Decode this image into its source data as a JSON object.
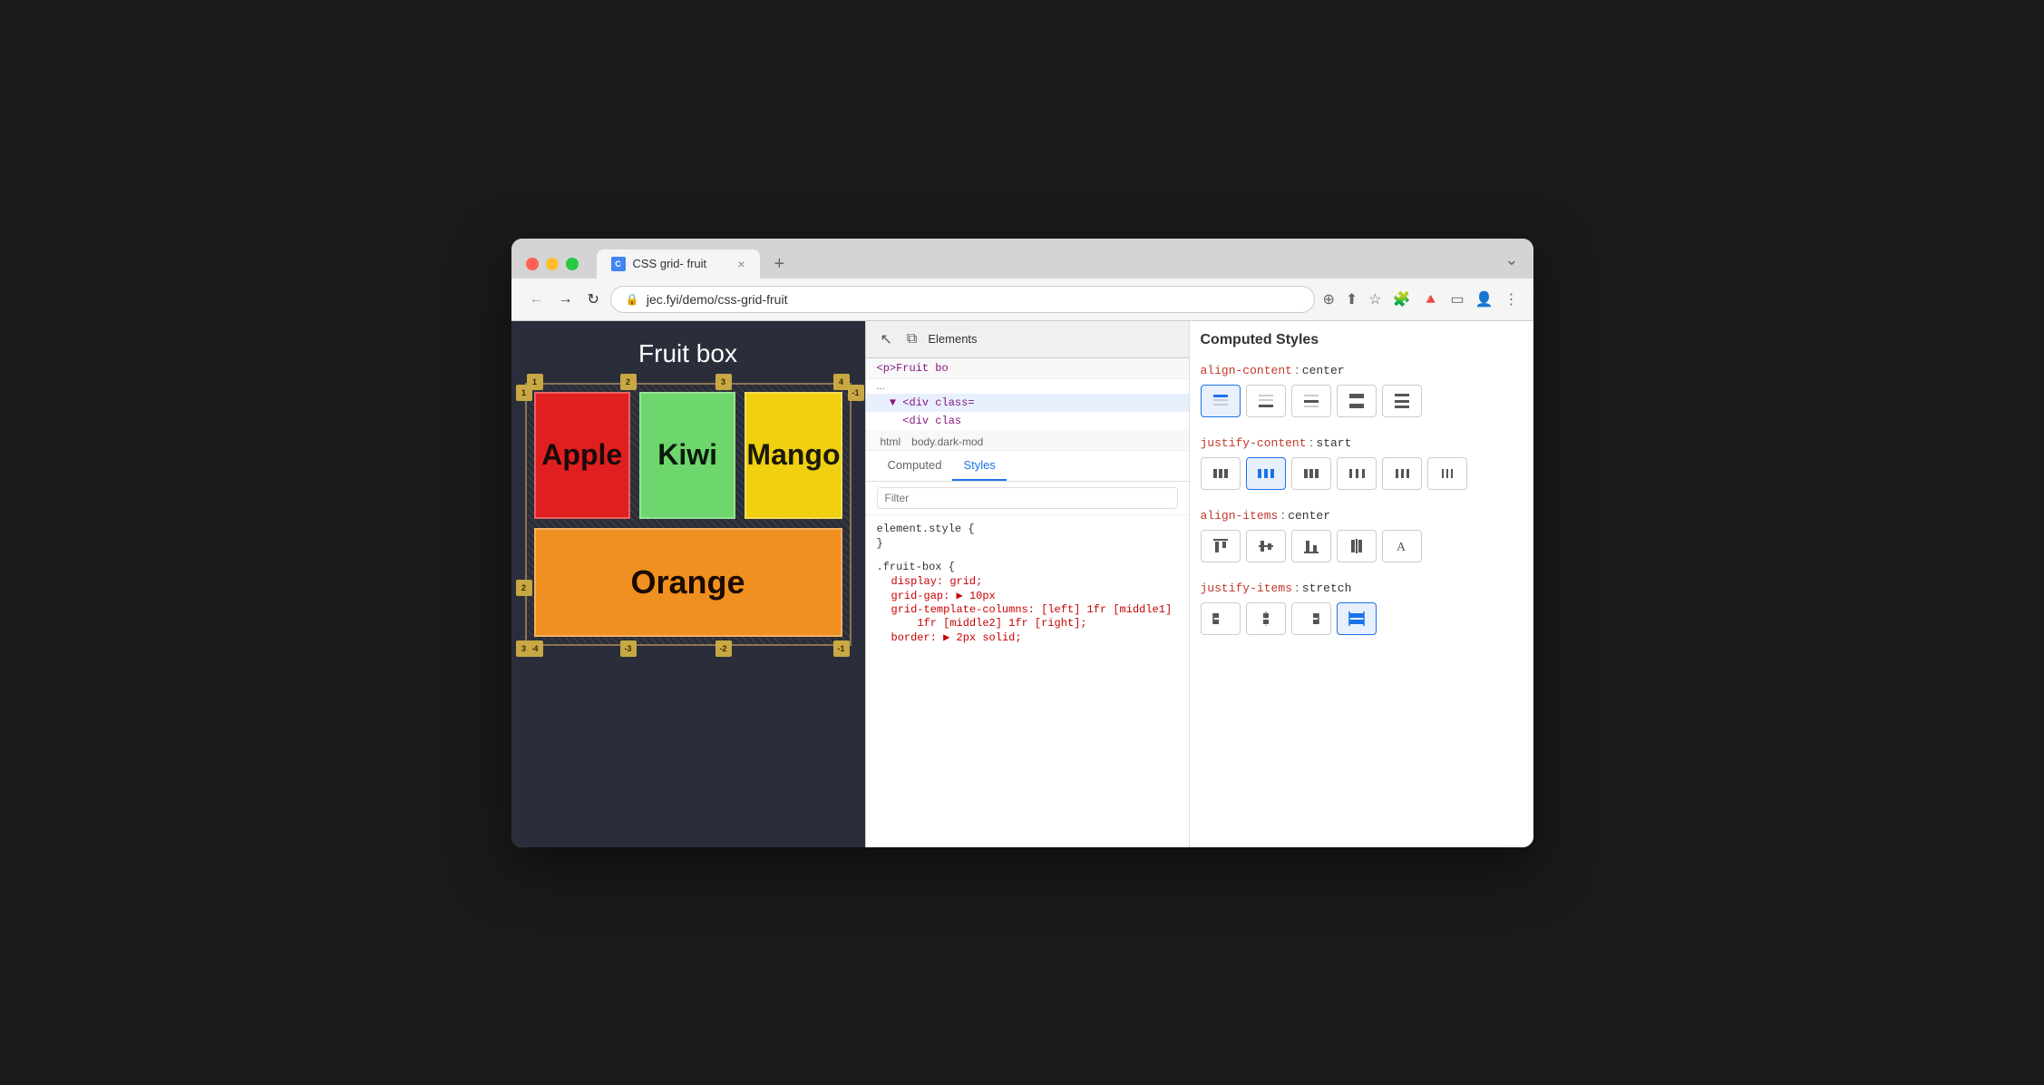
{
  "window": {
    "title": "CSS grid- fruit",
    "tab_favicon": "C",
    "url": "jec.fyi/demo/css-grid-fruit",
    "new_tab_label": "+"
  },
  "traffic_lights": {
    "red_label": "close",
    "yellow_label": "minimize",
    "green_label": "maximize"
  },
  "nav": {
    "back_icon": "←",
    "forward_icon": "→",
    "refresh_icon": "↻",
    "lock_icon": "🔒"
  },
  "webpage": {
    "title": "Fruit box",
    "fruits": [
      {
        "name": "Apple",
        "color": "#e02020",
        "text_color": "#1a0a0a"
      },
      {
        "name": "Kiwi",
        "color": "#6dd66d",
        "text_color": "#0a1a0a"
      },
      {
        "name": "Mango",
        "color": "#f0d010",
        "text_color": "#1a1a0a"
      },
      {
        "name": "Orange",
        "color": "#f09020",
        "text_color": "#1a0a00"
      }
    ]
  },
  "devtools": {
    "panel_title": "Elements",
    "dom_lines": [
      "<p>Fruit bo",
      "<div class=",
      "<div clas"
    ],
    "selectors": [
      "html",
      "body.dark-mod"
    ],
    "subtabs": [
      {
        "label": "Computed",
        "active": false
      },
      {
        "label": "Styles",
        "active": true
      }
    ],
    "filter_placeholder": "Filter",
    "styles": {
      "element_style": "element.style {",
      "element_style_close": "}",
      "fruit_box_selector": ".fruit-box {",
      "properties": [
        {
          "name": "display",
          "value": "grid"
        },
        {
          "name": "grid-gap",
          "value": "▶ 10px"
        },
        {
          "name": "grid-template-columns",
          "value": "[left] 1fr [middle1]"
        },
        {
          "name": "grid-template-columns_2",
          "value": "1fr [middle2] 1fr [right];"
        },
        {
          "name": "border",
          "value": "▶ 2px solid;"
        }
      ]
    }
  },
  "computed_panel": {
    "title": "Computed Styles",
    "properties": [
      {
        "name": "align-content",
        "value": "center",
        "buttons": [
          {
            "icon": "align-content-start",
            "active": true,
            "symbol": "≡"
          },
          {
            "icon": "align-content-end",
            "active": false,
            "symbol": "≡"
          },
          {
            "icon": "align-content-center",
            "active": false,
            "symbol": "≡"
          },
          {
            "icon": "align-content-stretch",
            "active": false,
            "symbol": "≡"
          },
          {
            "icon": "align-content-space",
            "active": false,
            "symbol": "≡"
          }
        ]
      },
      {
        "name": "justify-content",
        "value": "start",
        "buttons": [
          {
            "icon": "justify-start",
            "active": false,
            "symbol": "⫶"
          },
          {
            "icon": "justify-center",
            "active": true,
            "symbol": "⫶"
          },
          {
            "icon": "justify-end",
            "active": false,
            "symbol": "⫶"
          },
          {
            "icon": "justify-space-between",
            "active": false,
            "symbol": "⫶"
          },
          {
            "icon": "justify-space-around",
            "active": false,
            "symbol": "⫶"
          },
          {
            "icon": "justify-space-evenly",
            "active": false,
            "symbol": "⫶"
          }
        ]
      },
      {
        "name": "align-items",
        "value": "center",
        "buttons": [
          {
            "icon": "align-items-start",
            "active": false,
            "symbol": "⊞"
          },
          {
            "icon": "align-items-center",
            "active": false,
            "symbol": "⊞"
          },
          {
            "icon": "align-items-end",
            "active": false,
            "symbol": "⊞"
          },
          {
            "icon": "align-items-stretch",
            "active": false,
            "symbol": "⊞"
          },
          {
            "icon": "align-items-baseline",
            "active": false,
            "symbol": "A"
          }
        ]
      },
      {
        "name": "justify-items",
        "value": "stretch",
        "buttons": [
          {
            "icon": "justify-items-start",
            "active": false,
            "symbol": "⫶"
          },
          {
            "icon": "justify-items-center",
            "active": false,
            "symbol": "⫶"
          },
          {
            "icon": "justify-items-end",
            "active": false,
            "symbol": "⫶"
          },
          {
            "icon": "justify-items-stretch",
            "active": true,
            "symbol": "⊞"
          }
        ]
      }
    ]
  }
}
